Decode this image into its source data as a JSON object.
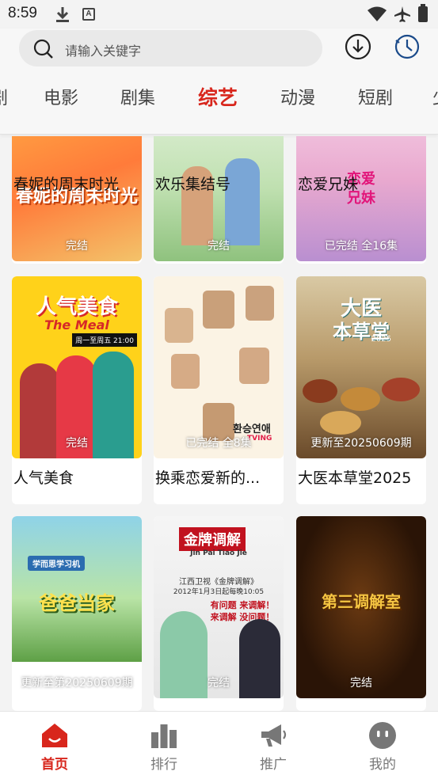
{
  "status": {
    "time": "8:59",
    "a_icon": "A"
  },
  "search": {
    "placeholder": "请输入关键字"
  },
  "tabs": [
    "剧",
    "电影",
    "剧集",
    "综艺",
    "动漫",
    "短剧",
    "少"
  ],
  "active_tab": "综艺",
  "cards": [
    {
      "title": "春妮的周末时光",
      "badge": "完结"
    },
    {
      "title": "欢乐集结号",
      "badge": "完结"
    },
    {
      "title": "恋爱兄妹",
      "badge": "已完结 全16集"
    },
    {
      "title": "人气美食",
      "badge": "完结"
    },
    {
      "title": "换乘恋爱新的...",
      "badge": "已完结 全8集"
    },
    {
      "title": "大医本草堂2025",
      "badge": "更新至20250609期"
    },
    {
      "title": "",
      "badge": "更新至第20250609期"
    },
    {
      "title": "",
      "badge": "完结"
    },
    {
      "title": "",
      "badge": "完结"
    }
  ],
  "poster_text": {
    "p0": "春妮的周末时光",
    "p2a": "恋爱",
    "p2b": "兄妹",
    "p3a": "人气美食",
    "p3b": "The Meal",
    "p3c": "周一至周五 21:00",
    "p4a": "환승연애",
    "p4b": "TVING",
    "p5a": "大医",
    "p5b": "本草堂",
    "p5c": "2025",
    "p6a": "学而思学习机",
    "p6b": "爸爸当家",
    "p7a": "金牌调解",
    "p7b": "Jin Pai   Tiao Jie",
    "p7c": "江西卫视《金牌调解》",
    "p7d": "2012年1月3日起每晚10:05",
    "p7e": "有问题 来调解！",
    "p7f": "来调解 没问题！",
    "p8a": "第三调解室"
  },
  "nav": [
    {
      "label": "首页",
      "icon": "home-icon"
    },
    {
      "label": "排行",
      "icon": "ranking-icon"
    },
    {
      "label": "推广",
      "icon": "megaphone-icon"
    },
    {
      "label": "我的",
      "icon": "profile-icon"
    }
  ],
  "colors": {
    "accent": "#d8261c",
    "bg": "#f3f3f3"
  }
}
